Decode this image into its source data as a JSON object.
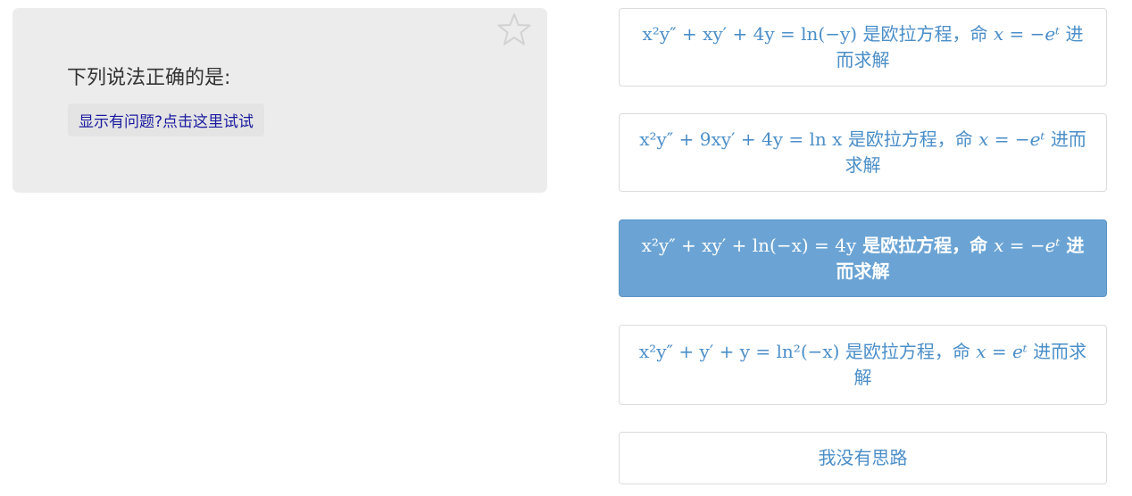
{
  "question": {
    "title": "下列说法正确的是:",
    "help_link": "显示有问题?点击这里试试",
    "favorite_icon": "star-outline-icon"
  },
  "options": [
    {
      "id": "a",
      "equation": "x²y″ + xy′ + 4y = ln(−y)",
      "text_after_eq": "是欧拉方程，命",
      "substitution": "x = −eᵗ",
      "text_end": "进而求解",
      "selected": false
    },
    {
      "id": "b",
      "equation": "x²y″ + 9xy′ + 4y = ln x",
      "text_after_eq": "是欧拉方程，命",
      "substitution": "x = −eᵗ",
      "text_end": "进而求解",
      "selected": false
    },
    {
      "id": "c",
      "equation": "x²y″ + xy′ + ln(−x) = 4y",
      "text_after_eq": "是欧拉方程，命",
      "substitution": "x = −eᵗ",
      "text_end": "进而求解",
      "selected": true
    },
    {
      "id": "d",
      "equation": "x²y″ + y′ + y = ln²(−x)",
      "text_after_eq": "是欧拉方程，命",
      "substitution": "x = eᵗ",
      "text_end": "进而求解",
      "selected": false
    },
    {
      "id": "e",
      "label": "我没有思路",
      "selected": false
    }
  ],
  "colors": {
    "option_text": "#4a8ec8",
    "selected_bg": "#6ba4d4",
    "card_bg": "#ececec",
    "link_text": "#1a1aa0"
  }
}
